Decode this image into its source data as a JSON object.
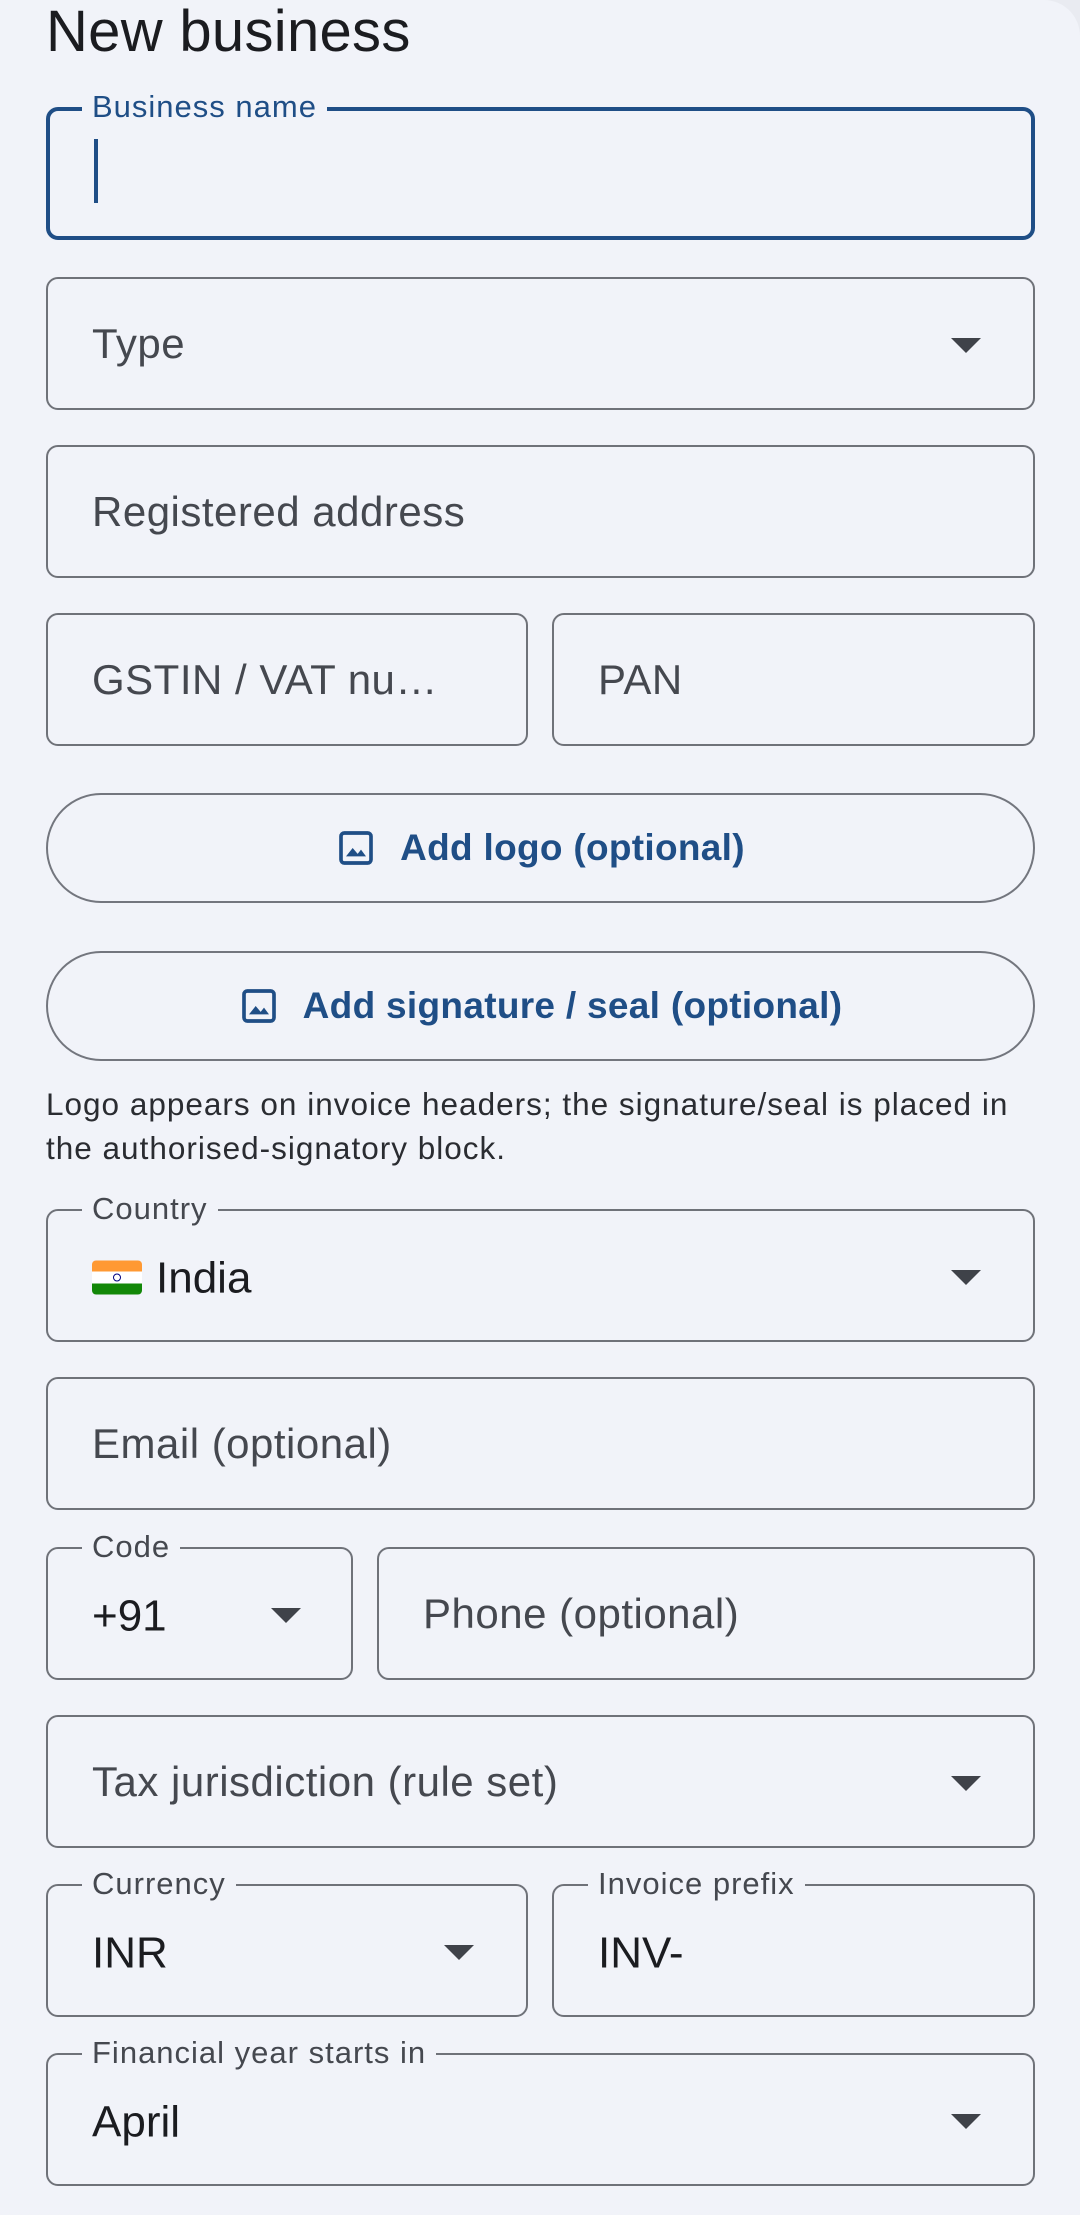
{
  "header": {
    "title": "New business"
  },
  "form": {
    "business_name": {
      "label": "Business name",
      "value": ""
    },
    "type": {
      "placeholder": "Type"
    },
    "registered_address": {
      "placeholder": "Registered address"
    },
    "gstin": {
      "placeholder": "GSTIN / VAT nu…"
    },
    "pan": {
      "placeholder": "PAN"
    },
    "add_logo": {
      "label": "Add logo (optional)",
      "icon": "image-icon"
    },
    "add_signature": {
      "label": "Add signature / seal (optional)",
      "icon": "image-icon"
    },
    "helper_text": "Logo appears on invoice headers; the signature/seal is placed in the authorised-signatory block.",
    "country": {
      "label": "Country",
      "value": "India",
      "flag": "india-flag-icon"
    },
    "email": {
      "placeholder": "Email (optional)"
    },
    "phone_code": {
      "label": "Code",
      "value": "+91"
    },
    "phone": {
      "placeholder": "Phone (optional)"
    },
    "tax_jurisdiction": {
      "placeholder": "Tax jurisdiction (rule set)"
    },
    "currency": {
      "label": "Currency",
      "value": "INR"
    },
    "invoice_prefix": {
      "label": "Invoice prefix",
      "value": "INV-"
    },
    "financial_year_start": {
      "label": "Financial year starts in",
      "value": "April"
    }
  },
  "colors": {
    "accent": "#1f4e86",
    "background": "#f1f3f9",
    "outline": "#6f7279"
  }
}
